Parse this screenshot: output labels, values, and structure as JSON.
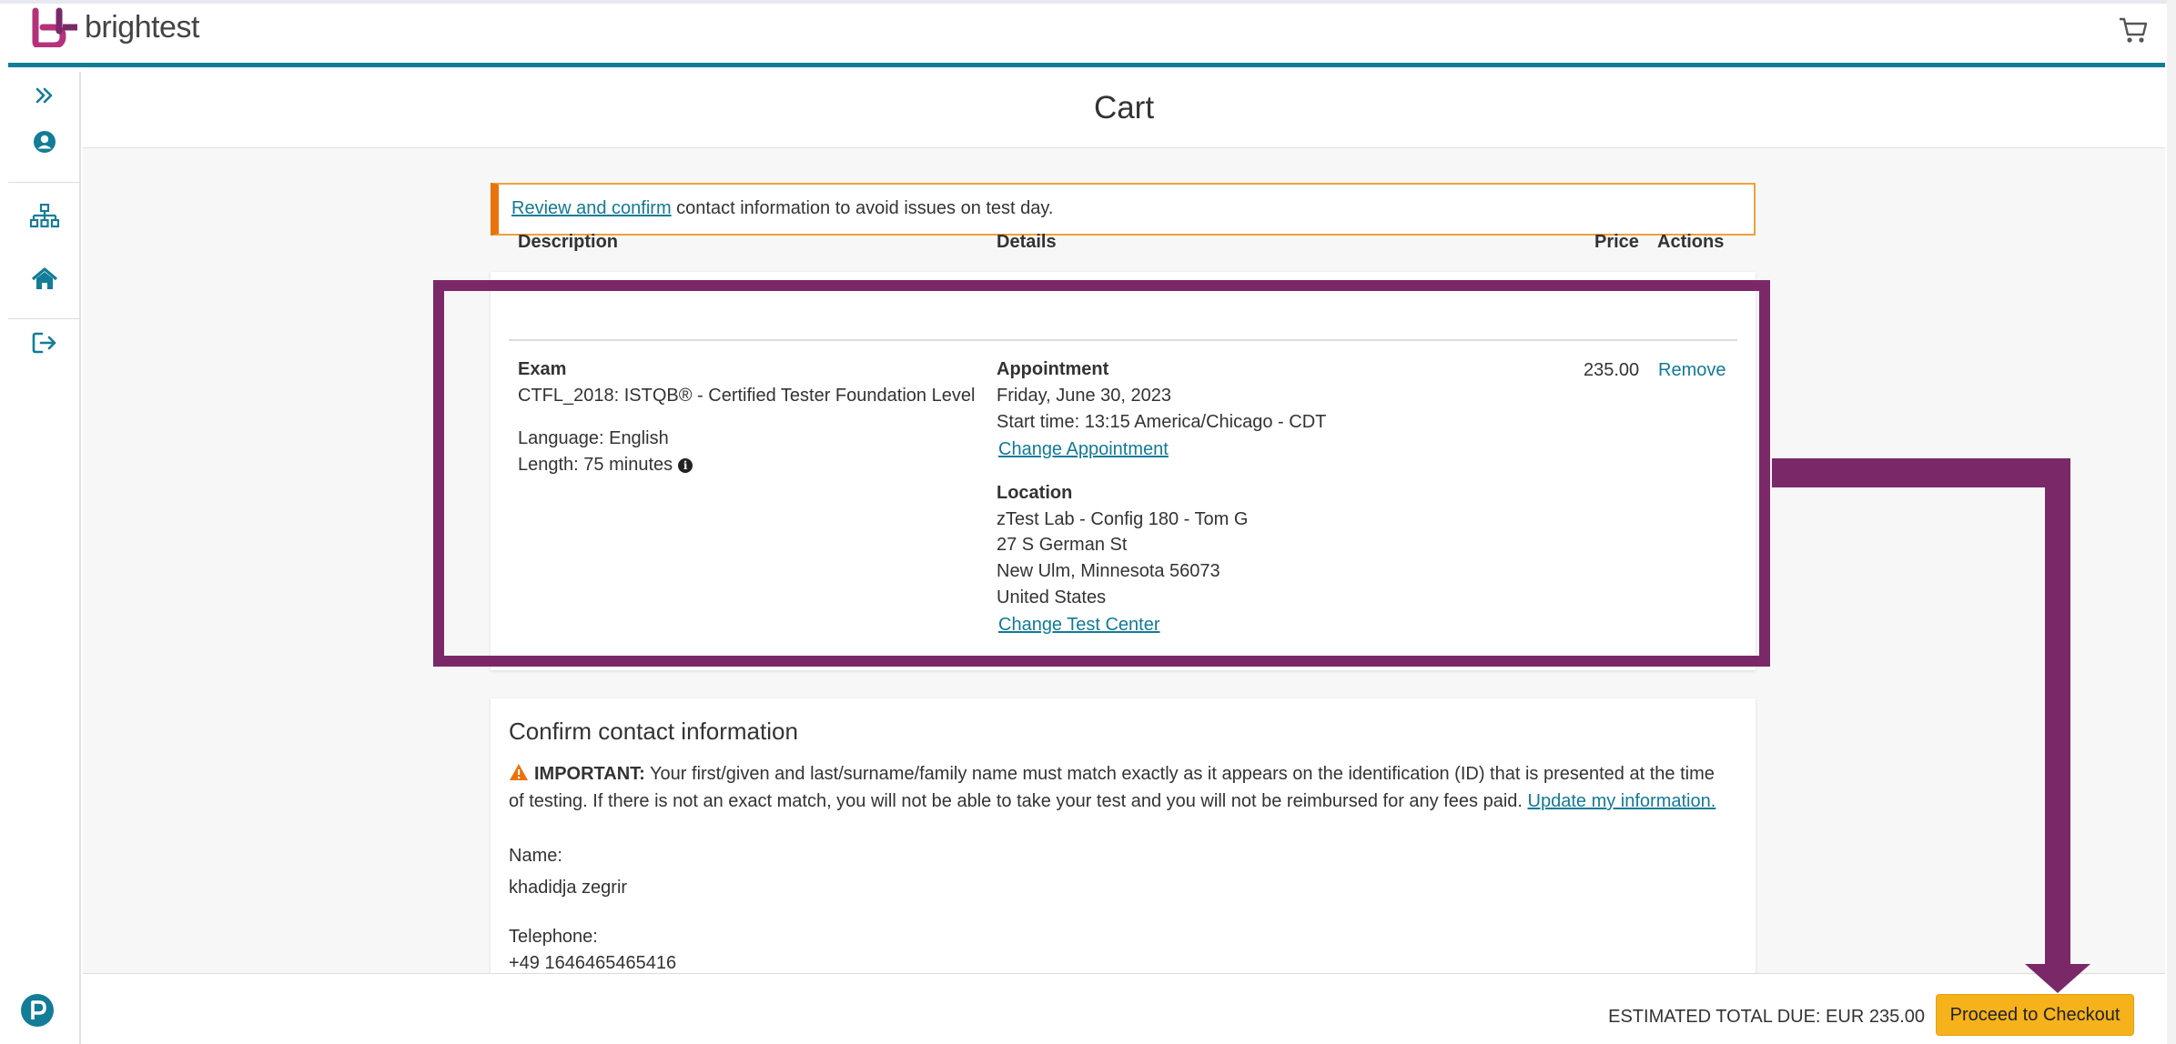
{
  "brand": {
    "name": "brightest"
  },
  "page": {
    "title": "Cart"
  },
  "notice": {
    "link_text": "Review and confirm",
    "text": " contact information to avoid issues on test day."
  },
  "table": {
    "headers": {
      "description": "Description",
      "details": "Details",
      "price": "Price",
      "actions": "Actions"
    },
    "item": {
      "type_label": "Exam",
      "exam_name": "CTFL_2018: ISTQB® - Certified Tester Foundation Level",
      "language": "Language: English",
      "length": "Length: 75 minutes",
      "appointment_label": "Appointment",
      "date": "Friday, June 30, 2023",
      "start_time": "Start time: 13:15 America/Chicago - CDT",
      "change_appointment": "Change Appointment",
      "location_label": "Location",
      "location_name": "zTest Lab - Config 180 - Tom G",
      "street": "27 S German St",
      "city": "New Ulm, Minnesota 56073",
      "country": "United States",
      "change_test_center": "Change Test Center",
      "price": "235.00",
      "remove": "Remove"
    }
  },
  "contact": {
    "title": "Confirm contact information",
    "important_label": "IMPORTANT:",
    "important_text": " Your first/given and last/surname/family name must match exactly as it appears on the identification (ID) that is presented at the time of testing. If there is not an exact match, you will not be able to take your test and you will not be reimbursed for any fees paid. ",
    "update_link": "Update my information.",
    "name_label": "Name:",
    "name_value": "khadidja zegrir",
    "phone_label": "Telephone:",
    "phone_value": "+49 1646465465416"
  },
  "footer": {
    "total": "ESTIMATED TOTAL DUE: EUR 235.00",
    "checkout": "Proceed to Checkout"
  },
  "colors": {
    "accent": "#137c97",
    "highlight": "#7b2869",
    "button": "#f6b21b",
    "notice_border": "#e9730c"
  },
  "icons": [
    "expand-icon",
    "user-icon",
    "sitemap-icon",
    "home-icon",
    "logout-icon",
    "cart-icon",
    "pearson-icon",
    "info-icon",
    "warning-icon"
  ]
}
